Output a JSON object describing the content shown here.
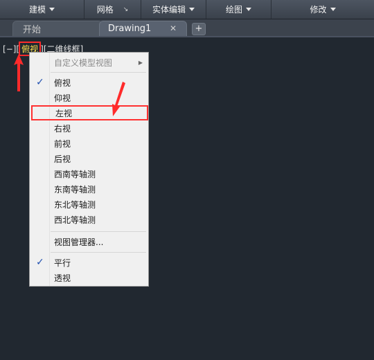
{
  "ribbon": {
    "items": [
      {
        "label": "建模",
        "has_dropdown": true
      },
      {
        "label": "网格",
        "has_launcher": true
      },
      {
        "label": "实体编辑",
        "has_dropdown": true
      },
      {
        "label": "绘图",
        "has_dropdown": true
      },
      {
        "label": "修改",
        "has_dropdown": true
      }
    ],
    "launcher_icon": "↘"
  },
  "tabs": {
    "start_label": "开始",
    "drawing_label": "Drawing1",
    "close_icon": "✕",
    "add_icon": "+"
  },
  "viewport": {
    "open": "[",
    "minus": "−",
    "close1": "][",
    "view": "俯视",
    "close2": "][",
    "visual_style": "二维线框",
    "close3": "]"
  },
  "menu": {
    "custom_views": "自定义模型视图",
    "items": [
      {
        "label": "俯视",
        "checked": true
      },
      {
        "label": "仰视"
      },
      {
        "label": "左视",
        "highlighted": true
      },
      {
        "label": "右视"
      },
      {
        "label": "前视"
      },
      {
        "label": "后视"
      },
      {
        "label": "西南等轴测"
      },
      {
        "label": "东南等轴测"
      },
      {
        "label": "东北等轴测"
      },
      {
        "label": "西北等轴测"
      }
    ],
    "view_manager": "视图管理器...",
    "parallel": "平行",
    "perspective": "透视",
    "check_mark": "✓",
    "submenu_arrow": "▶"
  },
  "colors": {
    "background": "#212830",
    "highlight_red": "#ff2b2b",
    "view_label_yellow": "#ffe14b"
  }
}
